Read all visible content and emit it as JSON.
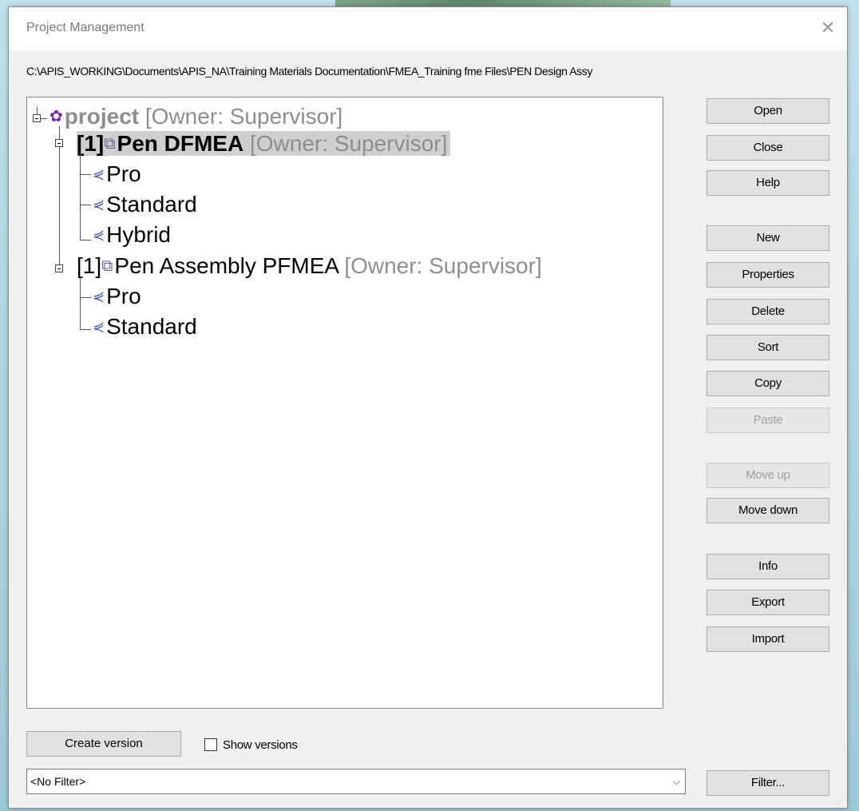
{
  "window": {
    "title": "Project Management",
    "close_icon": "close-icon"
  },
  "path": "C:\\APIS_WORKING\\Documents\\APIS_NA\\Training Materials  Documentation\\FMEA_Training fme Files\\PEN Design  Assy",
  "tree": {
    "root": {
      "label": "project",
      "owner": "[Owner: Supervisor]",
      "icon": "project-icon"
    },
    "items": [
      {
        "prefix": "[1]",
        "label": "Pen DFMEA",
        "owner": "[Owner: Supervisor]",
        "icon": "fmea-doc-icon",
        "selected": true,
        "children": [
          "Pro",
          "Standard",
          "Hybrid"
        ]
      },
      {
        "prefix": "[1]",
        "label": "Pen Assembly PFMEA",
        "owner": "[Owner: Supervisor]",
        "icon": "fmea-doc-icon",
        "selected": false,
        "children": [
          "Pro",
          "Standard"
        ]
      }
    ]
  },
  "buttons": {
    "open": "Open",
    "close": "Close",
    "help": "Help",
    "new": "New",
    "properties": "Properties",
    "delete": "Delete",
    "sort": "Sort",
    "copy": "Copy",
    "paste": "Paste",
    "move_up": "Move up",
    "move_down": "Move down",
    "info": "Info",
    "export": "Export",
    "import": "Import",
    "filter": "Filter..."
  },
  "bottom": {
    "create_version": "Create version",
    "show_versions": "Show versions",
    "show_versions_checked": false,
    "filter_value": "<No Filter>"
  }
}
